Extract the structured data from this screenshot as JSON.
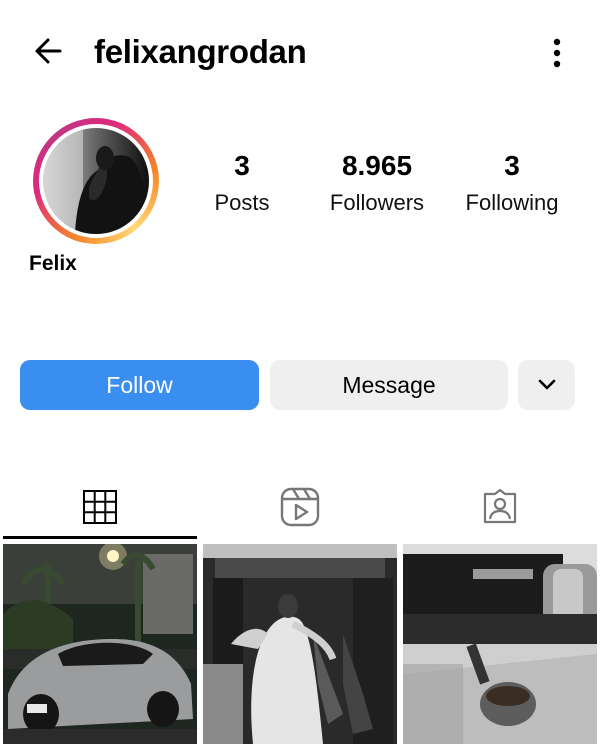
{
  "header": {
    "username": "felixangrodan",
    "back_icon": "arrow-left-icon",
    "more_icon": "vertical-dots-icon"
  },
  "profile": {
    "display_name": "Felix",
    "stats": [
      {
        "value": "3",
        "label": "Posts"
      },
      {
        "value": "8.965",
        "label": "Followers"
      },
      {
        "value": "3",
        "label": "Following"
      }
    ]
  },
  "actions": {
    "follow_label": "Follow",
    "message_label": "Message",
    "more_icon": "chevron-down-icon"
  },
  "tabs": [
    {
      "icon": "grid-icon",
      "selected": true
    },
    {
      "icon": "reels-icon",
      "selected": false
    },
    {
      "icon": "tagged-icon",
      "selected": false
    }
  ],
  "colors": {
    "follow_button": "#3a8ef0",
    "secondary_button": "#efefef",
    "text": "#000000"
  }
}
